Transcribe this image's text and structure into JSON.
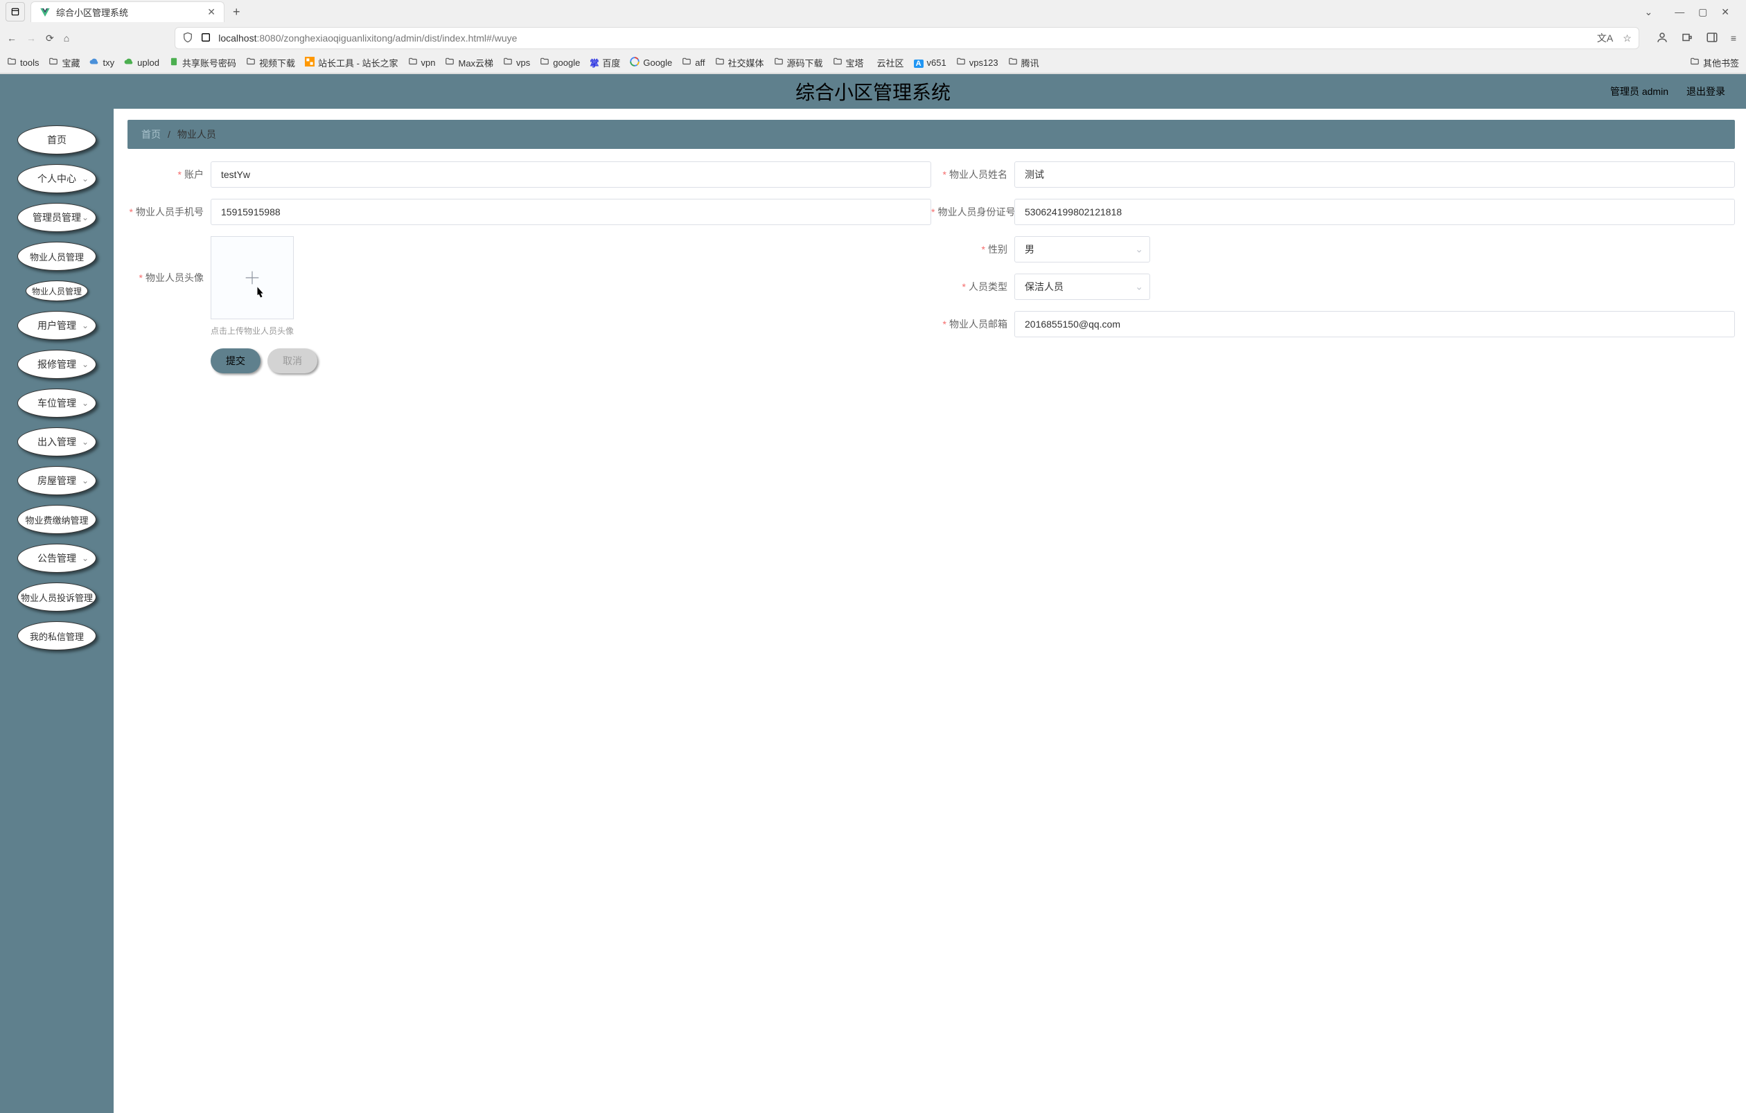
{
  "browser": {
    "tab_title": "综合小区管理系统",
    "url_host": "localhost",
    "url_port": ":8080",
    "url_path": "/zonghexiaoqiguanlixitong/admin/dist/index.html#/wuye"
  },
  "bookmarks": [
    {
      "icon": "folder",
      "label": "tools"
    },
    {
      "icon": "folder",
      "label": "宝藏"
    },
    {
      "icon": "cloud-blue",
      "label": "txy"
    },
    {
      "icon": "cloud-green",
      "label": "uplod"
    },
    {
      "icon": "doc-green",
      "label": "共享账号密码"
    },
    {
      "icon": "folder",
      "label": "视频下载"
    },
    {
      "icon": "site-tool",
      "label": "站长工具 - 站长之家"
    },
    {
      "icon": "folder",
      "label": "vpn"
    },
    {
      "icon": "folder",
      "label": "Max云梯"
    },
    {
      "icon": "folder",
      "label": "vps"
    },
    {
      "icon": "folder",
      "label": "google"
    },
    {
      "icon": "baidu",
      "label": "百度"
    },
    {
      "icon": "google",
      "label": "Google"
    },
    {
      "icon": "folder",
      "label": "aff"
    },
    {
      "icon": "folder",
      "label": "社交媒体"
    },
    {
      "icon": "folder",
      "label": "源码下载"
    },
    {
      "icon": "folder",
      "label": "宝塔"
    },
    {
      "icon": "text",
      "label": "云社区"
    },
    {
      "icon": "v651",
      "label": "v651"
    },
    {
      "icon": "folder",
      "label": "vps123"
    },
    {
      "icon": "folder",
      "label": "腾讯"
    }
  ],
  "bookmark_other": "其他书签",
  "app": {
    "title": "综合小区管理系统",
    "user_label": "管理员 admin",
    "logout": "退出登录"
  },
  "sidebar": {
    "items": [
      {
        "label": "首页",
        "expandable": false
      },
      {
        "label": "个人中心",
        "expandable": true
      },
      {
        "label": "管理员管理",
        "expandable": true
      },
      {
        "label": "物业人员管理",
        "expandable": false,
        "wide": true
      },
      {
        "label": "物业人员管理",
        "sub": true
      },
      {
        "label": "用户管理",
        "expandable": true
      },
      {
        "label": "报修管理",
        "expandable": true
      },
      {
        "label": "车位管理",
        "expandable": true
      },
      {
        "label": "出入管理",
        "expandable": true
      },
      {
        "label": "房屋管理",
        "expandable": true
      },
      {
        "label": "物业费缴纳管理",
        "expandable": false,
        "wide": true
      },
      {
        "label": "公告管理",
        "expandable": true
      },
      {
        "label": "物业人员投诉管理",
        "expandable": false,
        "wide": true
      },
      {
        "label": "我的私信管理",
        "expandable": false,
        "wide": true
      }
    ]
  },
  "breadcrumb": {
    "home": "首页",
    "current": "物业人员"
  },
  "form": {
    "account": {
      "label": "账户",
      "value": "testYw"
    },
    "staff_name": {
      "label": "物业人员姓名",
      "value": "测试"
    },
    "staff_phone": {
      "label": "物业人员手机号",
      "value": "15915915988"
    },
    "staff_idcard": {
      "label": "物业人员身份证号",
      "value": "530624199802121818"
    },
    "staff_avatar": {
      "label": "物业人员头像",
      "hint": "点击上传物业人员头像"
    },
    "gender": {
      "label": "性别",
      "value": "男"
    },
    "staff_type": {
      "label": "人员类型",
      "value": "保洁人员"
    },
    "staff_email": {
      "label": "物业人员邮箱",
      "value": "2016855150@qq.com"
    }
  },
  "buttons": {
    "submit": "提交",
    "cancel": "取消"
  }
}
